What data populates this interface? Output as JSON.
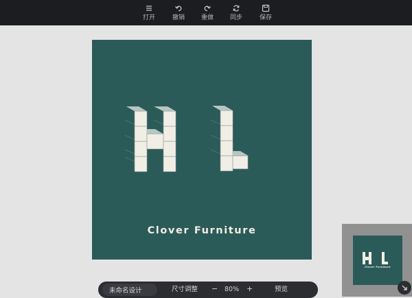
{
  "toolbar": {
    "open": {
      "label": "打开",
      "icon": "menu-icon"
    },
    "undo": {
      "label": "撤销",
      "icon": "undo-icon"
    },
    "redo": {
      "label": "重做",
      "icon": "redo-icon"
    },
    "sync": {
      "label": "同步",
      "icon": "sync-icon"
    },
    "save": {
      "label": "保存",
      "icon": "save-icon"
    }
  },
  "canvas": {
    "background": "#2b5b58",
    "logo_letters": "H L",
    "brand_text": "Clover Furniture"
  },
  "bottom_bar": {
    "doc_name": "未命名设计",
    "resize_label": "尺寸调整",
    "zoom_out": "−",
    "zoom_level": "80%",
    "zoom_in": "+",
    "preview_label": "预览"
  },
  "minimap": {
    "brand_text": "Clover Furniture",
    "toggle_icon": "collapse-arrow-icon"
  }
}
